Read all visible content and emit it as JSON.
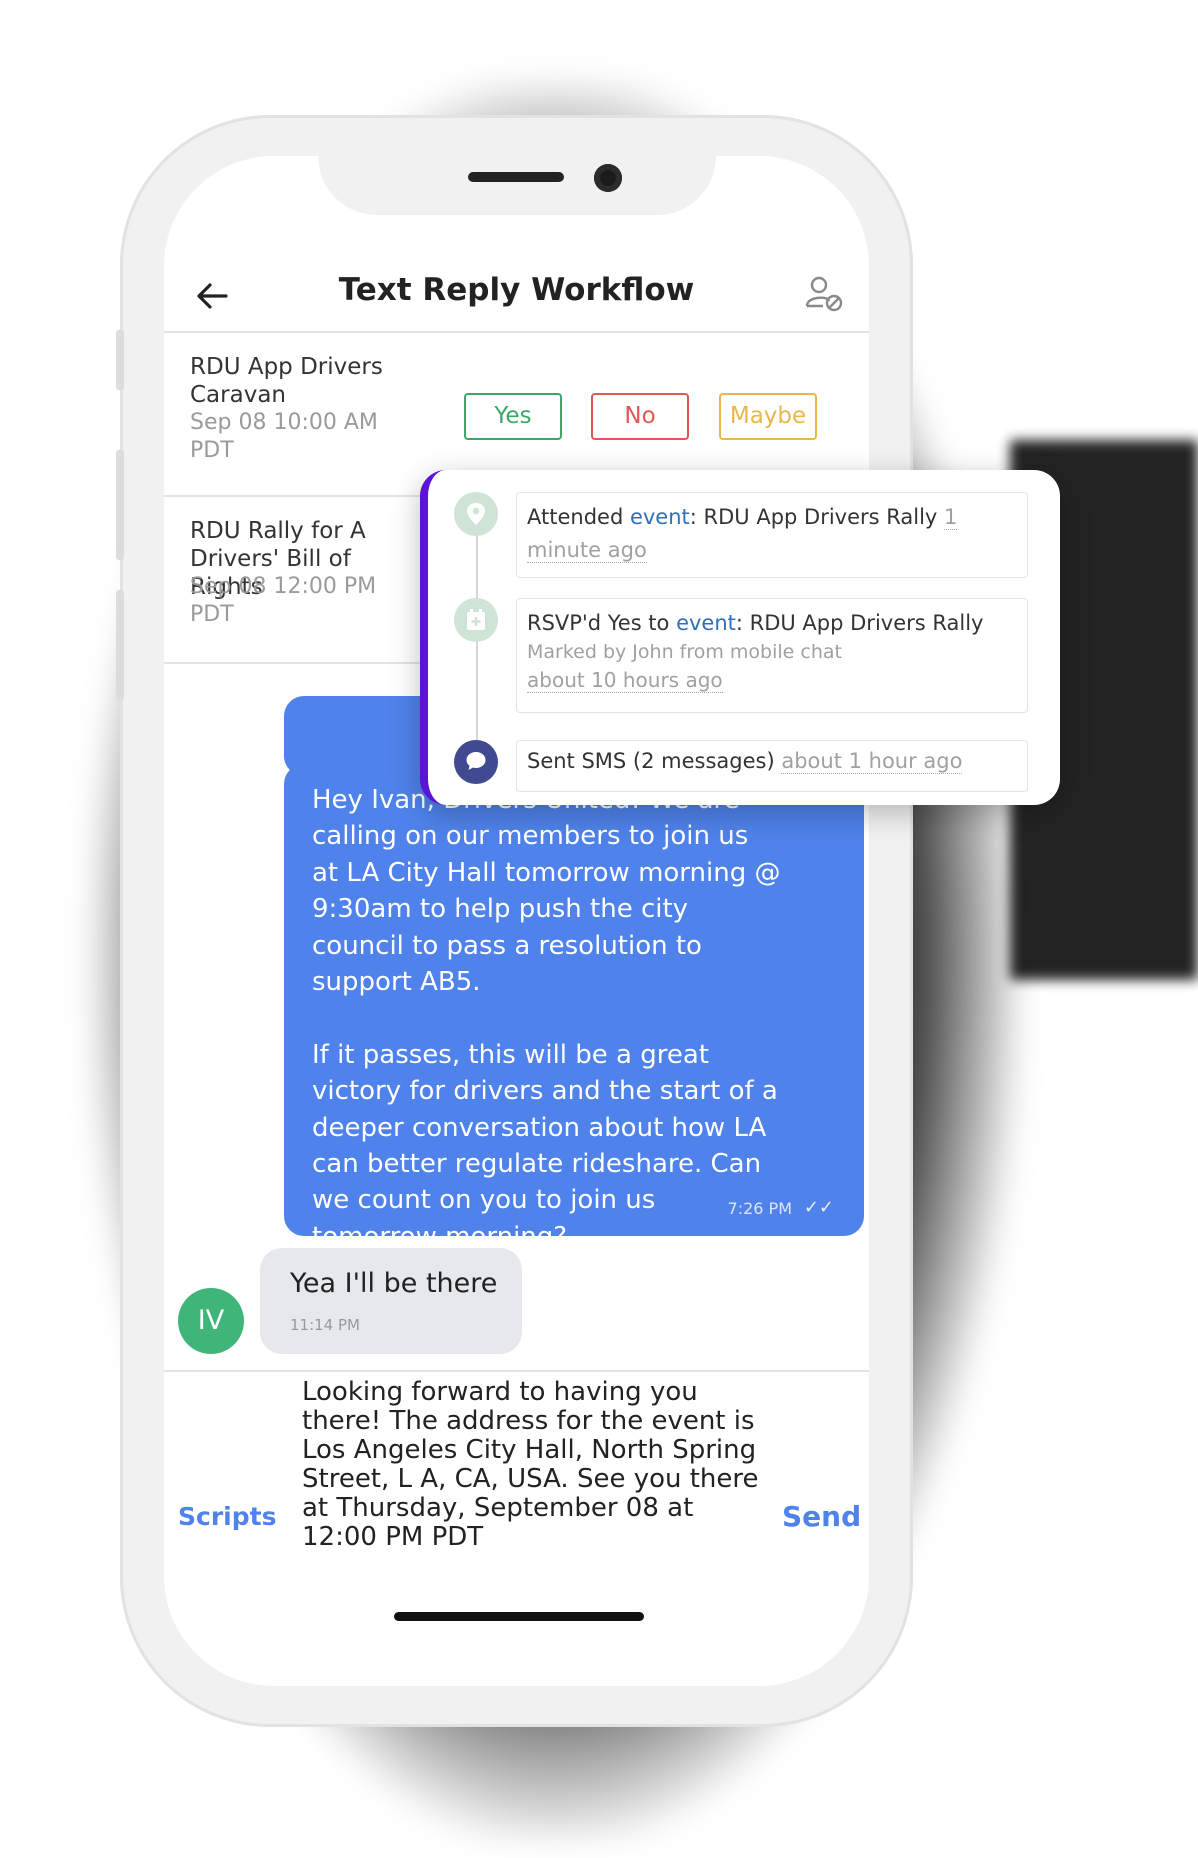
{
  "header": {
    "title": "Text Reply Workflow"
  },
  "events": [
    {
      "name": "RDU App Drivers Caravan",
      "date": "Sep 08 10:00 AM PDT"
    },
    {
      "name": "RDU Rally for A Drivers' Bill of Rights",
      "date": "Sep 08 12:00 PM PDT"
    }
  ],
  "rsvp": {
    "yes": "Yes",
    "no": "No",
    "maybe": "Maybe"
  },
  "colors": {
    "yes": "#3fa66a",
    "no": "#e05757",
    "maybe": "#eab64a",
    "accent": "#4f82ea",
    "timeline_accent": "#5a14d6"
  },
  "chat": {
    "outgoing_text": "Hey Ivan, Drivers United! We are calling on our members to join us at LA City Hall tomorrow morning @ 9:30am to help push the city council to pass a resolution to support AB5.\n\nIf it passes, this will be a great victory for drivers and the start of a deeper conversation about how LA can better regulate rideshare. Can we count on you to join us tomorrow morning?",
    "outgoing_time": "7:26 PM",
    "incoming_text": "Yea I'll be there",
    "incoming_time": "11:14 PM",
    "avatar_initials": "IV"
  },
  "composer": {
    "scripts_label": "Scripts",
    "draft": "Looking forward to having you there! The address for the event is Los Angeles City Hall, North Spring Street, L A, CA, USA. See you there at Thursday, September 08 at 12:00 PM PDT",
    "send_label": "Send"
  },
  "timeline": [
    {
      "icon": "location-pin-icon",
      "prefix": "Attended ",
      "link": "event",
      "suffix": ": RDU App Drivers Rally ",
      "time": "1 minute ago"
    },
    {
      "icon": "calendar-icon",
      "prefix": "RSVP'd Yes to ",
      "link": "event",
      "suffix": ": RDU App Drivers Rally",
      "note": "Marked by John from mobile chat",
      "time": "about 10 hours ago"
    },
    {
      "icon": "chat-bubble-icon",
      "prefix": "Sent SMS (2 messages) ",
      "time": "about 1 hour ago"
    }
  ]
}
